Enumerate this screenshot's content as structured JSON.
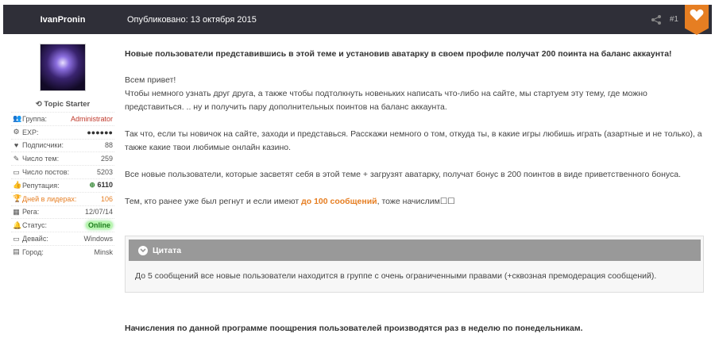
{
  "header": {
    "author": "IvanPronin",
    "date": "Опубликовано: 13 октября 2015",
    "post_number": "#1",
    "share_icon": "share-icon",
    "heart_icon": "heart-icon",
    "accent_color": "#e67e22"
  },
  "sidebar": {
    "topic_starter": "Topic Starter",
    "stats": [
      {
        "icon": "users-icon",
        "label": "Группа:",
        "value": "Administrator"
      },
      {
        "icon": "exp-icon",
        "label": "EXP:",
        "value": "●●●●●●"
      },
      {
        "icon": "heart-icon",
        "label": "Подписчики:",
        "value": "88"
      },
      {
        "icon": "comments-icon",
        "label": "Число тем:",
        "value": "259"
      },
      {
        "icon": "comment-icon",
        "label": "Число постов:",
        "value": "5203"
      },
      {
        "icon": "thumbs-up-icon",
        "label": "Репутация:",
        "value": "6110"
      },
      {
        "icon": "trophy-icon",
        "label": "Дней в лидерах:",
        "value": "106"
      },
      {
        "icon": "calendar-icon",
        "label": "Рега:",
        "value": "12/07/14"
      },
      {
        "icon": "bell-icon",
        "label": "Статус:",
        "value": "Online"
      },
      {
        "icon": "monitor-icon",
        "label": "Девайс:",
        "value": "Windows"
      },
      {
        "icon": "id-card-icon",
        "label": "Город:",
        "value": "Minsk"
      }
    ]
  },
  "post": {
    "headline": "Новые пользователи представившись в этой теме и установив аватарку в своем профиле получат 200 поинта на баланс аккаунта!",
    "greeting": "Всем привет!",
    "para1": "Чтобы немного узнать друг друга, а также чтобы подтолкнуть новеньких написать что-либо на сайте, мы стартуем эту тему, где можно представиться. .. ну и получить пару дополнительных поинтов на баланс аккаунта.",
    "para2": "Так что, если ты новичок на сайте, заходи и представься. Расскажи немного о том, откуда ты, в какие игры любишь играть (азартные и не только), а также какие твои любимые онлайн казино.",
    "para3": "Все новые пользователи, которые засветят себя в этой теме + загрузят аватарку, получат бонус в 200 поинтов в виде приветственного бонуса.",
    "para4_start": "Тем, кто ранее уже был регнут и если имеют ",
    "para4_highlight": "до 100 сообщений",
    "para4_end": ", тоже начислим☐☐",
    "quote_title": "Цитата",
    "quote_text": "До 5 сообщений все новые пользователи находится в группе с очень ограниченными правами (+сквозная премодерация сообщений).",
    "footer": "Начисления по данной программе поощрения пользователей производятся раз в неделю по понедельникам."
  }
}
